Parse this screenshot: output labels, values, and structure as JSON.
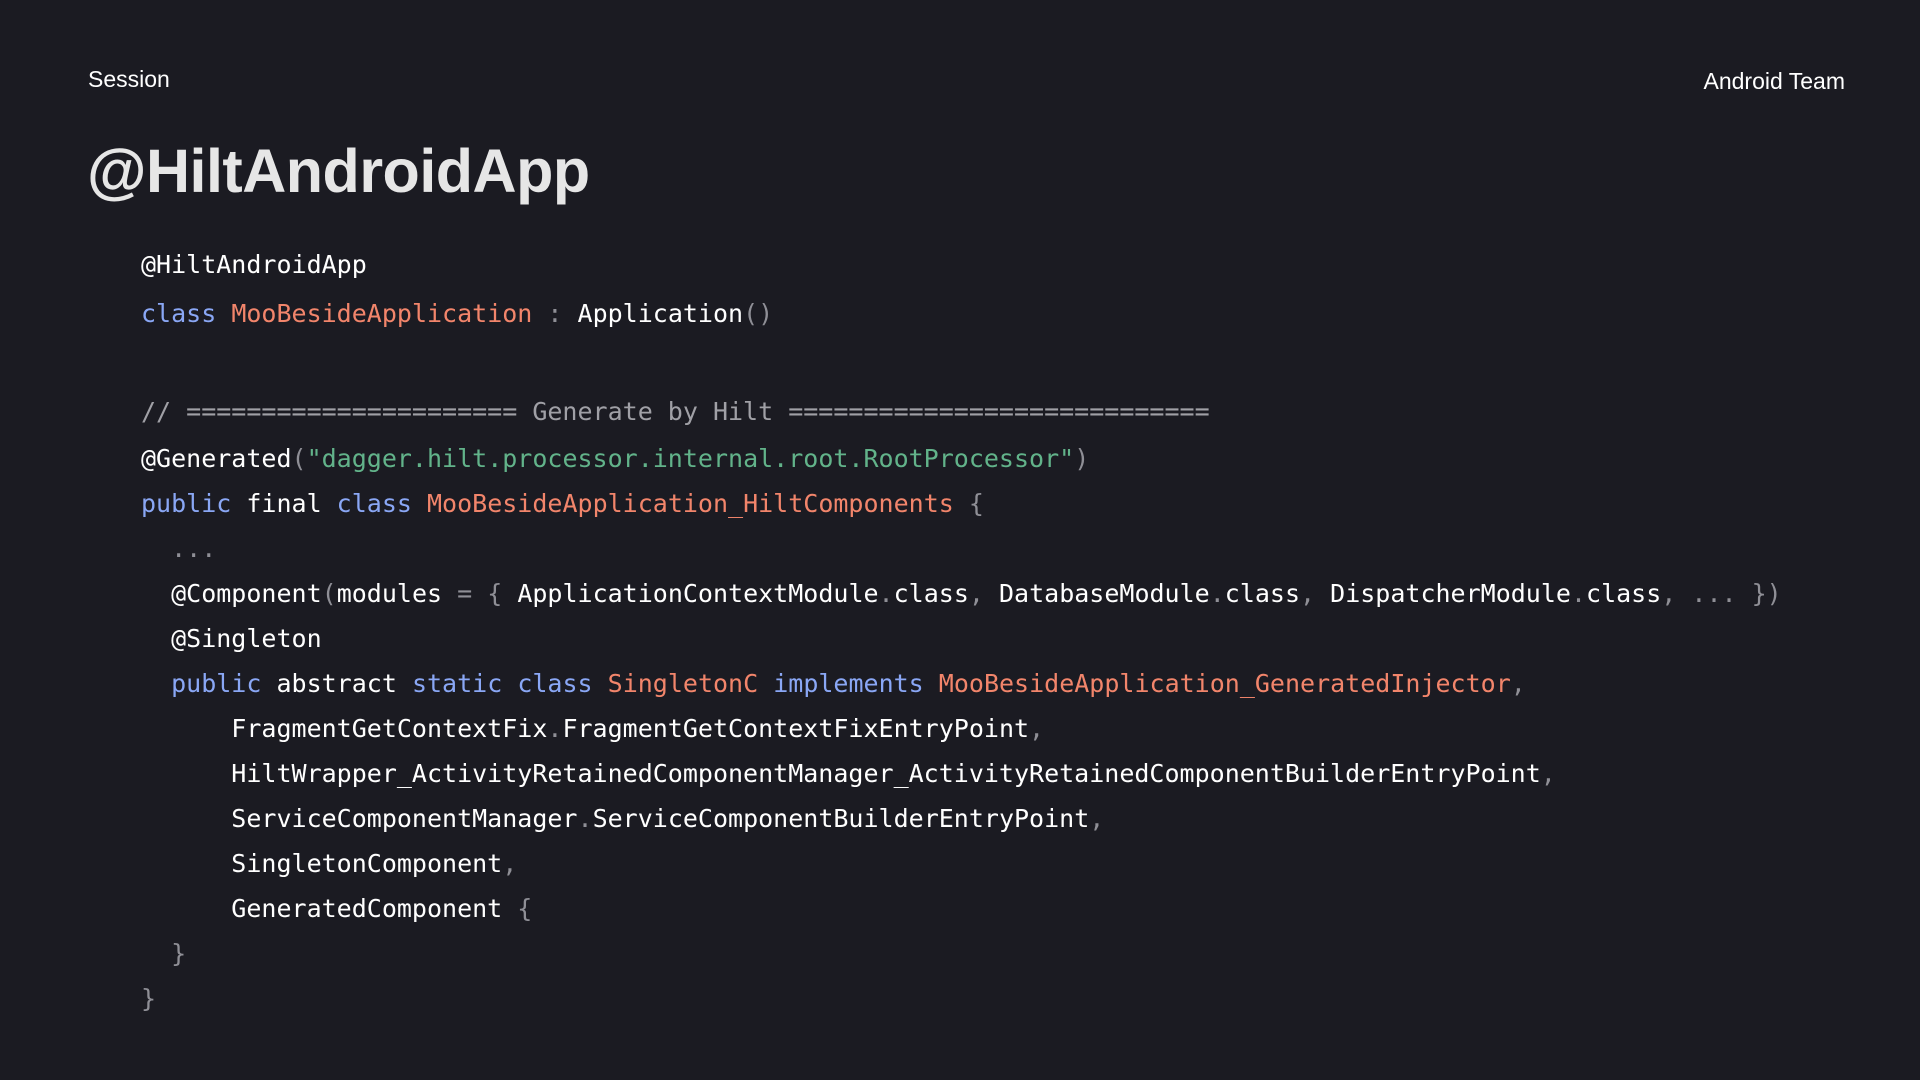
{
  "header": {
    "session": "Session",
    "team": "Android Team"
  },
  "title": "@HiltAndroidApp",
  "code": {
    "l1": [
      {
        "t": "@HiltAndroidApp",
        "c": "anno"
      }
    ],
    "l2": [
      {
        "t": "class",
        "c": "kw"
      },
      {
        "t": " ",
        "c": "plain"
      },
      {
        "t": "MooBesideApplication",
        "c": "cls"
      },
      {
        "t": " : ",
        "c": "punc"
      },
      {
        "t": "Application",
        "c": "plain"
      },
      {
        "t": "()",
        "c": "punc"
      }
    ],
    "l3": [
      {
        "t": "// ====================== Generate by Hilt ============================",
        "c": "comment"
      }
    ],
    "l4": [
      {
        "t": "@Generated",
        "c": "anno"
      },
      {
        "t": "(",
        "c": "punc"
      },
      {
        "t": "\"dagger.hilt.processor.internal.root.RootProcessor\"",
        "c": "str"
      },
      {
        "t": ")",
        "c": "punc"
      }
    ],
    "l5": [
      {
        "t": "public",
        "c": "kw"
      },
      {
        "t": " final ",
        "c": "plain"
      },
      {
        "t": "class",
        "c": "kw"
      },
      {
        "t": " ",
        "c": "plain"
      },
      {
        "t": "MooBesideApplication_HiltComponents",
        "c": "cls"
      },
      {
        "t": " {",
        "c": "punc"
      }
    ],
    "l6": [
      {
        "t": "  ...",
        "c": "punc"
      }
    ],
    "l7": [
      {
        "t": "  @Component",
        "c": "anno"
      },
      {
        "t": "(",
        "c": "punc"
      },
      {
        "t": "modules",
        "c": "plain"
      },
      {
        "t": " = { ",
        "c": "punc"
      },
      {
        "t": "ApplicationContextModule",
        "c": "plain"
      },
      {
        "t": ".",
        "c": "punc"
      },
      {
        "t": "class",
        "c": "plain"
      },
      {
        "t": ", ",
        "c": "punc"
      },
      {
        "t": "DatabaseModule",
        "c": "plain"
      },
      {
        "t": ".",
        "c": "punc"
      },
      {
        "t": "class",
        "c": "plain"
      },
      {
        "t": ", ",
        "c": "punc"
      },
      {
        "t": "DispatcherModule",
        "c": "plain"
      },
      {
        "t": ".",
        "c": "punc"
      },
      {
        "t": "class",
        "c": "plain"
      },
      {
        "t": ", ... })",
        "c": "punc"
      }
    ],
    "l8": [
      {
        "t": "  @Singleton",
        "c": "anno"
      }
    ],
    "l9": [
      {
        "t": "  public",
        "c": "kw"
      },
      {
        "t": " abstract ",
        "c": "plain"
      },
      {
        "t": "static",
        "c": "kw"
      },
      {
        "t": " ",
        "c": "plain"
      },
      {
        "t": "class",
        "c": "kw"
      },
      {
        "t": " ",
        "c": "plain"
      },
      {
        "t": "SingletonC",
        "c": "cls"
      },
      {
        "t": " ",
        "c": "plain"
      },
      {
        "t": "implements",
        "c": "kw"
      },
      {
        "t": " ",
        "c": "plain"
      },
      {
        "t": "MooBesideApplication_GeneratedInjector",
        "c": "cls"
      },
      {
        "t": ",",
        "c": "punc"
      }
    ],
    "l10": [
      {
        "t": "      FragmentGetContextFix",
        "c": "plain"
      },
      {
        "t": ".",
        "c": "punc"
      },
      {
        "t": "FragmentGetContextFixEntryPoint",
        "c": "plain"
      },
      {
        "t": ",",
        "c": "punc"
      }
    ],
    "l11": [
      {
        "t": "      HiltWrapper_ActivityRetainedComponentManager_ActivityRetainedComponentBuilderEntryPoint",
        "c": "plain"
      },
      {
        "t": ",",
        "c": "punc"
      }
    ],
    "l12": [
      {
        "t": "      ServiceComponentManager",
        "c": "plain"
      },
      {
        "t": ".",
        "c": "punc"
      },
      {
        "t": "ServiceComponentBuilderEntryPoint",
        "c": "plain"
      },
      {
        "t": ",",
        "c": "punc"
      }
    ],
    "l13": [
      {
        "t": "      SingletonComponent",
        "c": "plain"
      },
      {
        "t": ",",
        "c": "punc"
      }
    ],
    "l14": [
      {
        "t": "      GeneratedComponent",
        "c": "plain"
      },
      {
        "t": " {",
        "c": "punc"
      }
    ],
    "l15": [
      {
        "t": "  }",
        "c": "punc"
      }
    ],
    "l16": [
      {
        "t": "}",
        "c": "punc"
      }
    ]
  }
}
